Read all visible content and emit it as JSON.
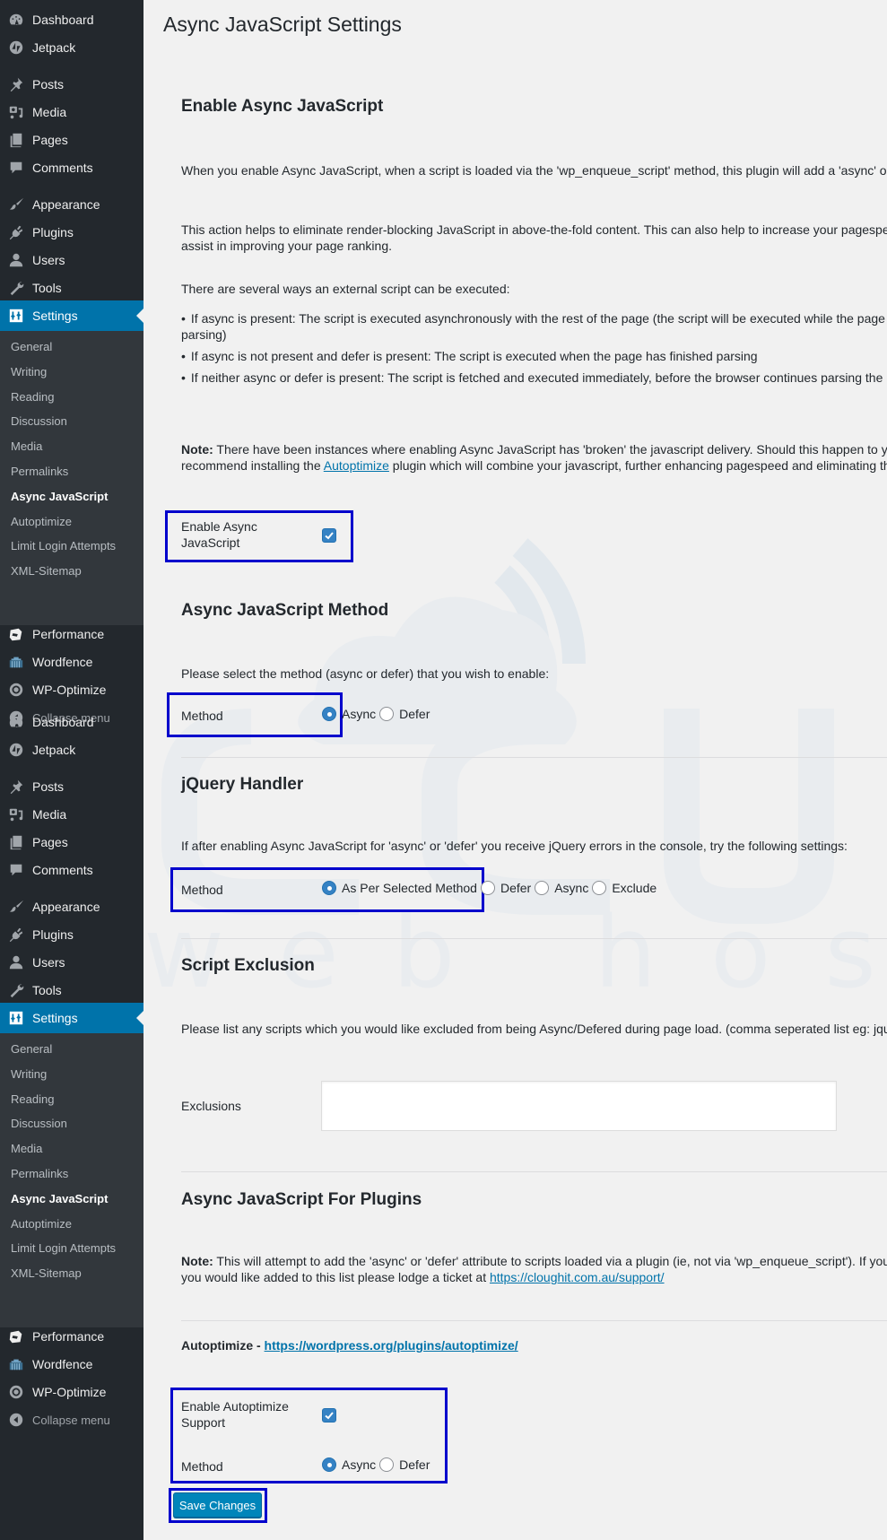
{
  "sidebar": {
    "blocks": [
      {
        "top_items": [
          {
            "label": "Dashboard",
            "icon": "dashboard-icon"
          },
          {
            "label": "Jetpack",
            "icon": "jetpack-icon"
          },
          {
            "label": "Posts",
            "icon": "pin-icon"
          },
          {
            "label": "Media",
            "icon": "media-icon"
          },
          {
            "label": "Pages",
            "icon": "pages-icon"
          },
          {
            "label": "Comments",
            "icon": "comment-icon"
          },
          {
            "label": "Appearance",
            "icon": "paintbrush-icon"
          },
          {
            "label": "Plugins",
            "icon": "plug-icon"
          },
          {
            "label": "Users",
            "icon": "user-icon"
          },
          {
            "label": "Tools",
            "icon": "wrench-icon"
          },
          {
            "label": "Settings",
            "icon": "sliders-icon",
            "active": true
          }
        ],
        "sub_items": [
          {
            "label": "General"
          },
          {
            "label": "Writing"
          },
          {
            "label": "Reading"
          },
          {
            "label": "Discussion"
          },
          {
            "label": "Media"
          },
          {
            "label": "Permalinks"
          },
          {
            "label": "Async JavaScript",
            "current": true
          },
          {
            "label": "Autoptimize"
          },
          {
            "label": "Limit Login Attempts"
          },
          {
            "label": "XML-Sitemap"
          }
        ],
        "bottom_items": [
          {
            "label": "Performance",
            "icon": "performance-icon"
          },
          {
            "label": "Wordfence",
            "icon": "wordfence-icon"
          },
          {
            "label": "WP-Optimize",
            "icon": "wp-optimize-icon"
          },
          {
            "label": "Collapse menu",
            "icon": "collapse-icon"
          }
        ]
      }
    ]
  },
  "page": {
    "title": "Async JavaScript Settings",
    "sections": {
      "enable": {
        "heading": "Enable Async JavaScript",
        "para1": "When you enable Async JavaScript, when a script is loaded via the 'wp_enqueue_script' method, this plugin will add a 'async' or 'defer' attribute.",
        "para2": "This action helps to eliminate render-blocking JavaScript in above-the-fold content. This can also help to increase your pagespeed which in turn will assist in improving your page ranking.",
        "para3": "There are several ways an external script can be executed:",
        "bullets": [
          "If async is present: The script is executed asynchronously with the rest of the page (the script will be executed while the page continues the parsing)",
          "If async is not present and defer is present: The script is executed when the page has finished parsing",
          "If neither async or defer is present: The script is fetched and executed immediately, before the browser continues parsing the page"
        ],
        "note_label": "Note:",
        "note_before": " There have been instances where enabling Async JavaScript has 'broken' the javascript delivery. Should this happen to you, I highly recommend installing the ",
        "note_link": "Autoptimize",
        "note_after": " plugin which will combine your javascript, further enhancing pagespeed and eliminating this issue.",
        "checkbox_label": "Enable Async JavaScript",
        "checkbox_checked": true
      },
      "method": {
        "heading": "Async JavaScript Method",
        "description": "Please select the method (async or defer) that you wish to enable:",
        "field_label": "Method",
        "options": [
          "Async",
          "Defer"
        ],
        "selected": "Async"
      },
      "jquery": {
        "heading": "jQuery Handler",
        "description": "If after enabling Async JavaScript for 'async' or 'defer' you receive jQuery errors in the console, try the following settings:",
        "field_label": "Method",
        "options": [
          "As Per Selected Method",
          "Defer",
          "Async",
          "Exclude"
        ],
        "selected": "As Per Selected Method"
      },
      "exclusion": {
        "heading": "Script Exclusion",
        "description": "Please list any scripts which you would like excluded from being Async/Defered during page load. (comma seperated list eg: jquery.js,jquery-ui.js)",
        "field_label": "Exclusions",
        "value": ""
      },
      "plugins": {
        "heading": "Async JavaScript For Plugins",
        "note_label": "Note:",
        "note_before": " This will attempt to add the 'async' or 'defer' attribute to scripts loaded via a plugin (ie, not via 'wp_enqueue_script'). If you have a plugin that you would like added to this list please lodge a ticket at ",
        "note_link": "https://cloughit.com.au/support/",
        "autoptimize_label": "Autoptimize - ",
        "autoptimize_link": "https://wordpress.org/plugins/autoptimize/",
        "enable_label": "Enable Autoptimize Support",
        "enable_checked": true,
        "method_label": "Method",
        "options": [
          "Async",
          "Defer"
        ],
        "selected": "Async"
      }
    },
    "save_label": "Save Changes"
  },
  "colors": {
    "sidebar_bg": "#23282d",
    "submenu_bg": "#32373c",
    "active": "#0073aa",
    "highlight_box": "#0000cc",
    "link": "#0073aa",
    "button": "#0085ba"
  }
}
